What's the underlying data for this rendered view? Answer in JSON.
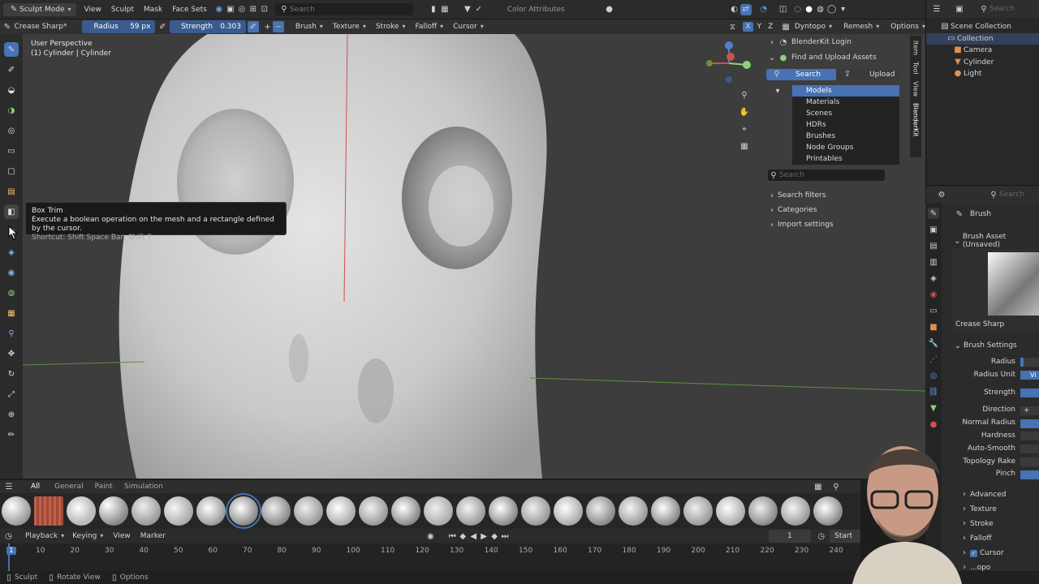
{
  "header": {
    "mode": "Sculpt Mode",
    "menus": [
      "View",
      "Sculpt",
      "Mask",
      "Face Sets"
    ],
    "search_placeholder": "Search",
    "color_attributes": "Color Attributes",
    "axes": [
      "X",
      "Y",
      "Z"
    ],
    "dyntopo": "Dyntopo",
    "remesh": "Remesh",
    "options": "Options"
  },
  "tool_settings": {
    "brush_name": "Crease Sharp*",
    "radius_label": "Radius",
    "radius_value": "59 px",
    "strength_label": "Strength",
    "strength_value": "0.303",
    "menus": [
      "Brush",
      "Texture",
      "Stroke",
      "Falloff",
      "Cursor"
    ]
  },
  "viewport": {
    "perspective": "User Perspective",
    "object": "(1) Cylinder | Cylinder"
  },
  "tooltip": {
    "title": "Box Trim",
    "description": "Execute a boolean operation on the mesh and a rectangle defined by the cursor.",
    "shortcut": "Shortcut: Shift Space Bar, Shift 7"
  },
  "blenderkit": {
    "login": "BlenderKit Login",
    "find_upload": "Find and Upload Assets",
    "search_tab": "Search",
    "upload_tab": "Upload",
    "categories": [
      "Models",
      "Materials",
      "Scenes",
      "HDRs",
      "Brushes",
      "Node Groups",
      "Printables"
    ],
    "search_placeholder": "Search",
    "search_filters": "Search filters",
    "categories_label": "Categories",
    "import_settings": "Import settings",
    "side_tabs": [
      "Item",
      "Tool",
      "View",
      "BlenderKit"
    ]
  },
  "outliner": {
    "search_placeholder": "Search",
    "scene_collection": "Scene Collection",
    "collection": "Collection",
    "items": [
      "Camera",
      "Cylinder",
      "Light"
    ]
  },
  "properties": {
    "search_placeholder": "Search",
    "brush_label": "Brush",
    "brush_asset": "Brush Asset (Unsaved)",
    "brush_name": "Crease Sharp",
    "brush_settings": "Brush Settings",
    "fields": [
      "Radius",
      "Radius Unit",
      "Strength",
      "Direction",
      "Normal Radius",
      "Hardness",
      "Auto-Smooth",
      "Topology Rake",
      "Pinch"
    ],
    "radius_unit_value": "Vi",
    "sections": [
      "Advanced",
      "Texture",
      "Stroke",
      "Falloff",
      "Cursor",
      "...opo"
    ]
  },
  "asset_shelf": {
    "tabs": [
      "All",
      "General",
      "Paint",
      "Simulation"
    ]
  },
  "timeline": {
    "menus": [
      "Playback",
      "Keying",
      "View",
      "Marker"
    ],
    "current_frame": "1",
    "start_label": "Start",
    "ticks": [
      "1",
      "10",
      "20",
      "30",
      "40",
      "50",
      "60",
      "70",
      "80",
      "90",
      "100",
      "110",
      "120",
      "130",
      "140",
      "150",
      "160",
      "170",
      "180",
      "190",
      "200",
      "210",
      "220",
      "230",
      "240"
    ]
  },
  "statusbar": {
    "items": [
      "Sculpt",
      "Rotate View",
      "Options"
    ]
  }
}
